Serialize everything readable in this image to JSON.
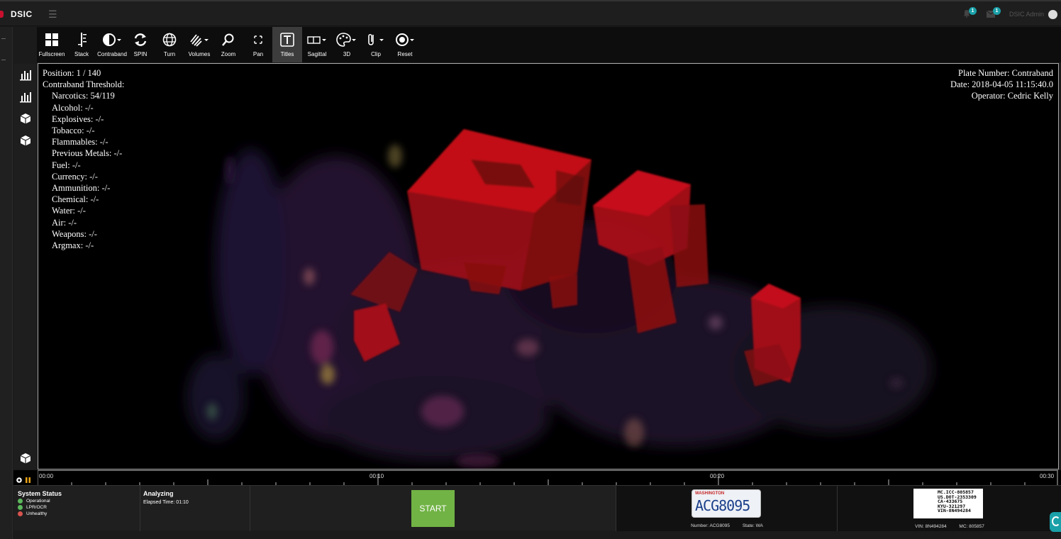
{
  "header": {
    "brand": "DSIC",
    "user_name": "DSIC Admin",
    "notifications_count": "1",
    "messages_count": "1"
  },
  "toolbar": {
    "tools": [
      {
        "label": "Fullscreen",
        "icon": "grid-icon"
      },
      {
        "label": "Stack",
        "icon": "stack-icon"
      },
      {
        "label": "Contraband",
        "icon": "contrast-icon"
      },
      {
        "label": "SPIN",
        "icon": "refresh-icon"
      },
      {
        "label": "Turn",
        "icon": "globe-icon"
      },
      {
        "label": "Volumes",
        "icon": "volumes-icon"
      },
      {
        "label": "Zoom",
        "icon": "search-icon"
      },
      {
        "label": "Pan",
        "icon": "move-icon"
      },
      {
        "label": "Titles",
        "icon": "text-icon",
        "active": true
      },
      {
        "label": "Sagittal",
        "icon": "sagittal-icon"
      },
      {
        "label": "3D",
        "icon": "palette-icon"
      },
      {
        "label": "Clip",
        "icon": "paperclip-icon"
      },
      {
        "label": "Reset",
        "icon": "target-icon"
      }
    ]
  },
  "viewer": {
    "position": "Position:  1 / 140",
    "threshold_title": "Contraband Threshold:",
    "thresholds": [
      "Narcotics:  54/119",
      "Alcohol:  -/-",
      "Explosives:  -/-",
      "Tobacco:  -/-",
      "Flammables:  -/-",
      "Previous Metals:  -/-",
      "Fuel:  -/-",
      "Currency:  -/-",
      "Ammunition:  -/-",
      "Chemical:  -/-",
      "Water:  -/-",
      "Air:  -/-",
      "Weapons:  -/-",
      "Argmax:  -/-"
    ],
    "plate_number": "Plate Number:  Contraband",
    "date": "Date:  2018-04-05 11:15:40.0",
    "operator": "Operator:  Cedric Kelly"
  },
  "timeline": {
    "labels": [
      "00:00",
      "00:10",
      "00:20",
      "00:30"
    ]
  },
  "status": {
    "title": "System Status",
    "items": [
      {
        "label": "Operational",
        "color": "#5cb85c"
      },
      {
        "label": "LPR/OCR",
        "color": "#5cb85c"
      },
      {
        "label": "Unhealthy",
        "color": "#d9534f"
      }
    ]
  },
  "analyzing": {
    "title": "Analyzing",
    "elapsed": "Elapsed Time: 01:10"
  },
  "start_label": "START",
  "plate": {
    "state_text": "WASHINGTON",
    "plate_text": "ACG8095",
    "number": "Number: ACG8095",
    "state": "State: WA"
  },
  "dot": {
    "lines": [
      "MC.ICC-805857",
      "US.DOT-2353309",
      "CA-433675",
      "KYU-321297",
      "VIN-8N494284"
    ],
    "vin": "VIN: 8N494284",
    "mc": "MC: 805857"
  },
  "colors": {
    "accent_green": "#71b345",
    "badge_teal": "#1aa0a8",
    "contraband_red": "#c8101a"
  }
}
